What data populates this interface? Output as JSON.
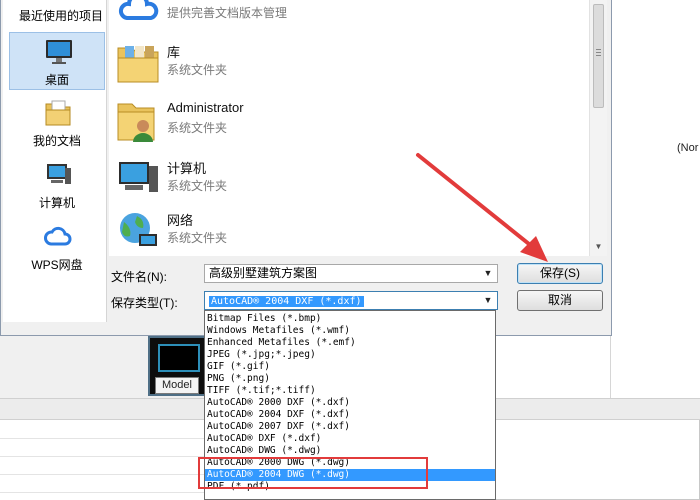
{
  "background": {
    "partial_text": "(Nor",
    "model_tab": "Model"
  },
  "dialog": {
    "top_hint": "提供完善文档版本管理",
    "sidebar": {
      "recent": "最近使用的项目",
      "items": [
        {
          "label": "桌面",
          "icon": "desktop-icon"
        },
        {
          "label": "我的文档",
          "icon": "documents-icon"
        },
        {
          "label": "计算机",
          "icon": "computer-icon"
        },
        {
          "label": "WPS网盘",
          "icon": "cloud-drive-icon"
        }
      ]
    },
    "files": [
      {
        "name": "库",
        "type": "系统文件夹",
        "icon": "library-folder-icon"
      },
      {
        "name": "Administrator",
        "type": "系统文件夹",
        "icon": "user-folder-icon"
      },
      {
        "name": "计算机",
        "type": "系统文件夹",
        "icon": "computer-icon"
      },
      {
        "name": "网络",
        "type": "系统文件夹",
        "icon": "network-globe-icon"
      }
    ],
    "filename_label": "文件名(N):",
    "filename_value": "高级别墅建筑方案图",
    "filetype_label": "保存类型(T):",
    "filetype_value": "AutoCAD® 2004 DXF (*.dxf)",
    "save_button": "保存(S)",
    "cancel_button": "取消"
  },
  "file_type_options": [
    "Bitmap Files (*.bmp)",
    "Windows Metafiles (*.wmf)",
    "Enhanced Metafiles (*.emf)",
    "JPEG (*.jpg;*.jpeg)",
    "GIF (*.gif)",
    "PNG (*.png)",
    "TIFF (*.tif;*.tiff)",
    "AutoCAD® 2000 DXF (*.dxf)",
    "AutoCAD® 2004 DXF (*.dxf)",
    "AutoCAD® 2007 DXF (*.dxf)",
    "AutoCAD® DXF (*.dxf)",
    "AutoCAD® DWG (*.dwg)",
    "AutoCAD® 2000 DWG (*.dwg)",
    "AutoCAD® 2004 DWG (*.dwg)",
    "PDF (*.pdf)"
  ],
  "selected_option_index": 13,
  "colors": {
    "selection": "#3399ff",
    "annotation": "#e23b3b"
  }
}
